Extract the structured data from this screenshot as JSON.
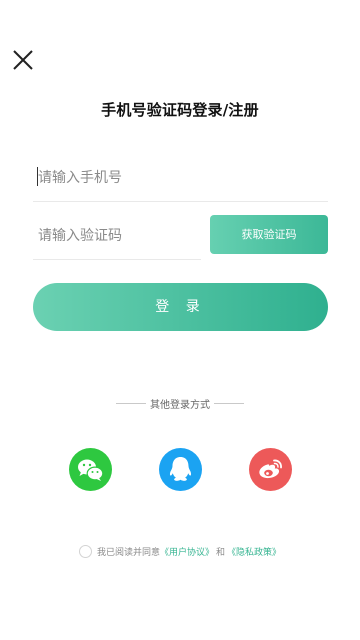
{
  "title": "手机号验证码登录/注册",
  "phone": {
    "placeholder": "请输入手机号",
    "value": ""
  },
  "code": {
    "placeholder": "请输入验证码",
    "value": "",
    "get_code_label": "获取验证码"
  },
  "login_label": "登 录",
  "other_login": {
    "label": "其他登录方式",
    "providers": [
      {
        "name": "wechat",
        "icon": "wechat-icon",
        "color": "#2ec840"
      },
      {
        "name": "qq",
        "icon": "qq-icon",
        "color": "#1ba3f2"
      },
      {
        "name": "weibo",
        "icon": "weibo-icon",
        "color": "#ed5959"
      }
    ]
  },
  "agreement": {
    "prefix": "我已阅读并同意",
    "user_agreement": "《用户协议》",
    "conjunction": "和",
    "privacy_policy": "《隐私政策》"
  },
  "colors": {
    "accent": "#3cb897",
    "accent_light": "#6bd1b2"
  }
}
